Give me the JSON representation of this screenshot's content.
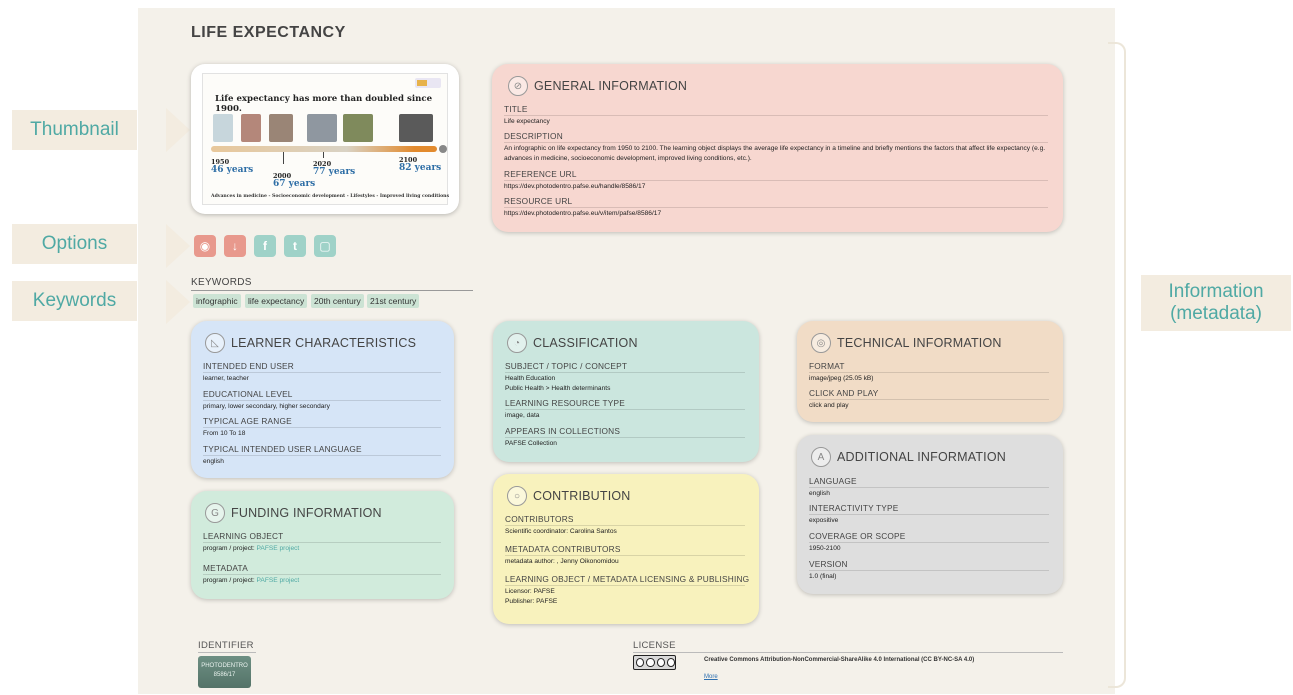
{
  "page_title": "LIFE EXPECTANCY",
  "callouts": {
    "thumbnail": "Thumbnail",
    "options": "Options",
    "keywords": "Keywords",
    "information_line1": "Information",
    "information_line2": "(metadata)"
  },
  "thumbnail": {
    "headline": "Life expectancy has more than doubled since 1900.",
    "milestones": [
      {
        "year": "1950",
        "value": "46 years"
      },
      {
        "year": "2000",
        "value": "67 years"
      },
      {
        "year": "2020",
        "value": "77 years"
      },
      {
        "year": "2100",
        "value": "82 years"
      }
    ],
    "footer": "Advances in medicine - Socioeconomic development - Lifestyles - Improved living conditions"
  },
  "options": [
    {
      "icon": "play-icon",
      "glyph": "◉",
      "color": "#e8998d"
    },
    {
      "icon": "download-icon",
      "glyph": "↓",
      "color": "#e8998d"
    },
    {
      "icon": "facebook-icon",
      "glyph": "f",
      "color": "#9fd2c8"
    },
    {
      "icon": "twitter-icon",
      "glyph": "t",
      "color": "#9fd2c8"
    },
    {
      "icon": "embed-icon",
      "glyph": "▢",
      "color": "#9fd2c8"
    }
  ],
  "keywords": {
    "label": "KEYWORDS",
    "items": [
      "infographic",
      "life expectancy",
      "20th century",
      "21st century"
    ]
  },
  "general": {
    "title": "GENERAL INFORMATION",
    "fields": [
      {
        "label": "TITLE",
        "value": "Life expectancy"
      },
      {
        "label": "DESCRIPTION",
        "value": "An infographic on life expectancy from 1950 to 2100. The learning object displays the average life expectancy in a timeline and briefly mentions the factors that affect life expectancy (e.g. advances in medicine, socioeconomic development, improved living conditions, etc.)."
      },
      {
        "label": "REFERENCE URL",
        "value": "https://dev.photodentro.pafse.eu/handle/8586/17"
      },
      {
        "label": "RESOURCE URL",
        "value": "https://dev.photodentro.pafse.eu/v/item/pafse/8586/17"
      }
    ]
  },
  "learner": {
    "title": "LEARNER CHARACTERISTICS",
    "fields": [
      {
        "label": "INTENDED END USER",
        "value": "learner, teacher"
      },
      {
        "label": "EDUCATIONAL LEVEL",
        "value": "primary, lower secondary, higher secondary"
      },
      {
        "label": "TYPICAL AGE RANGE",
        "value": "From 10 To 18"
      },
      {
        "label": "TYPICAL INTENDED USER LANGUAGE",
        "value": "english"
      }
    ]
  },
  "classification": {
    "title": "CLASSIFICATION",
    "fields": [
      {
        "label": "SUBJECT / TOPIC / CONCEPT",
        "value1": "Health Education",
        "value2": "Public Health > Health determinants"
      },
      {
        "label": "LEARNING RESOURCE TYPE",
        "value": "image, data"
      },
      {
        "label": "APPEARS IN COLLECTIONS",
        "value": "PAFSE Collection"
      }
    ]
  },
  "technical": {
    "title": "TECHNICAL INFORMATION",
    "fields": [
      {
        "label": "FORMAT",
        "value": "image/jpeg (25.05 kB)"
      },
      {
        "label": "CLICK AND PLAY",
        "value": "click and play"
      }
    ]
  },
  "funding": {
    "title": "FUNDING INFORMATION",
    "fields": [
      {
        "label": "LEARNING OBJECT",
        "prefix": "program / project:",
        "link": "PAFSE project"
      },
      {
        "label": "METADATA",
        "prefix": "program / project:",
        "link": "PAFSE project"
      }
    ]
  },
  "contribution": {
    "title": "CONTRIBUTION",
    "fields": [
      {
        "label": "CONTRIBUTORS",
        "value": "Scientific coordinator: Carolina Santos"
      },
      {
        "label": "METADATA CONTRIBUTORS",
        "value": "metadata author: , Jenny Oikonomidou"
      },
      {
        "label": "LEARNING OBJECT / METADATA LICENSING & PUBLISHING",
        "value1": "Licensor: PAFSE",
        "value2": "Publisher: PAFSE"
      }
    ]
  },
  "additional": {
    "title": "ADDITIONAL INFORMATION",
    "fields": [
      {
        "label": "LANGUAGE",
        "value": "english"
      },
      {
        "label": "INTERACTIVITY TYPE",
        "value": "expositive"
      },
      {
        "label": "COVERAGE OR SCOPE",
        "value": "1950-2100"
      },
      {
        "label": "VERSION",
        "value": "1.0 (final)"
      }
    ]
  },
  "identifier": {
    "label": "IDENTIFIER",
    "badge_line1": "PHOTODENTRO",
    "badge_line2": "8586/17"
  },
  "license": {
    "label": "LICENSE",
    "text": "Creative Commons Attribution-NonCommercial-ShareAlike 4.0 International (CC BY-NC-SA 4.0)",
    "more": "More"
  }
}
